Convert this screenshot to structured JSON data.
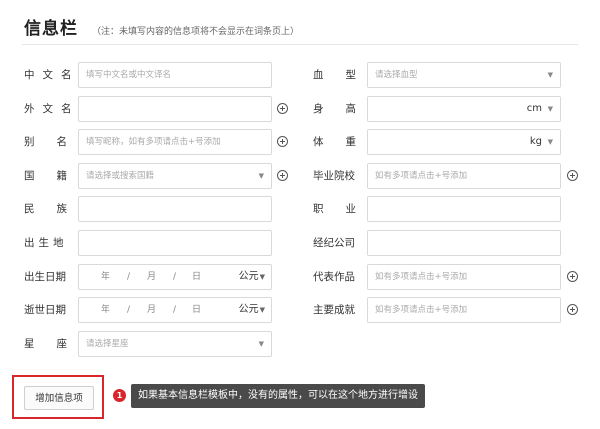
{
  "header": {
    "title": "信息栏",
    "note": "（注：未填写内容的信息项将不会显示在词条页上）"
  },
  "left": {
    "chinese_name": {
      "label": "中文名",
      "placeholder": "填写中文名或中文译名"
    },
    "foreign_name": {
      "label": "外文名",
      "value": ""
    },
    "alias": {
      "label": "别名",
      "placeholder": "填写昵称，如有多项请点击+号添加"
    },
    "nationality": {
      "label": "国籍",
      "placeholder": "请选择或搜索国籍"
    },
    "ethnicity": {
      "label": "民族",
      "value": ""
    },
    "birthplace": {
      "label": "出生地",
      "value": ""
    },
    "birth_date": {
      "label": "出生日期",
      "year": "年",
      "sep1": "/",
      "month": "月",
      "sep2": "/",
      "day": "日",
      "era": "公元"
    },
    "death_date": {
      "label": "逝世日期",
      "year": "年",
      "sep1": "/",
      "month": "月",
      "sep2": "/",
      "day": "日",
      "era": "公元"
    },
    "zodiac": {
      "label": "星座",
      "placeholder": "请选择星座"
    }
  },
  "right": {
    "blood_type": {
      "label": "血型",
      "placeholder": "请选择血型"
    },
    "height": {
      "label": "身高",
      "unit": "cm"
    },
    "weight": {
      "label": "体重",
      "unit": "kg"
    },
    "school": {
      "label": "毕业院校",
      "placeholder": "如有多项请点击+号添加"
    },
    "occupation": {
      "label": "职业",
      "value": ""
    },
    "agency": {
      "label": "经纪公司",
      "value": ""
    },
    "works": {
      "label": "代表作品",
      "placeholder": "如有多项请点击+号添加"
    },
    "achievements": {
      "label": "主要成就",
      "placeholder": "如有多项请点击+号添加"
    }
  },
  "add_button": {
    "label": "增加信息项"
  },
  "annotation": {
    "badge": "1",
    "text": "如果基本信息栏模板中，没有的属性，可以在这个地方进行增设"
  },
  "colors": {
    "highlight": "#d9262c",
    "tooltip_bg": "#4a4a4a"
  }
}
